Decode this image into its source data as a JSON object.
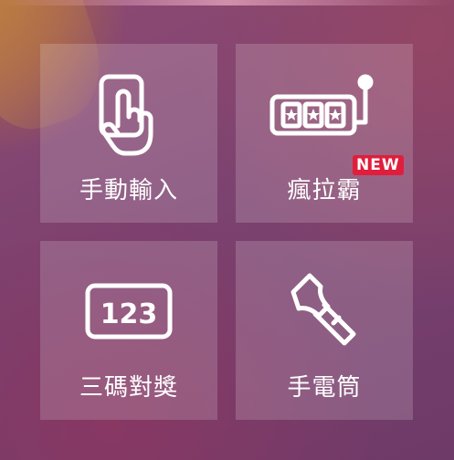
{
  "tiles": [
    {
      "label": "手動輸入",
      "icon": "hand-touch-icon"
    },
    {
      "label": "瘋拉霸",
      "icon": "slot-machine-icon",
      "badge": "NEW"
    },
    {
      "label": "三碼對獎",
      "icon": "number-123-icon",
      "icon_text": "123"
    },
    {
      "label": "手電筒",
      "icon": "flashlight-icon"
    }
  ],
  "colors": {
    "badge": "#e01e3c",
    "text": "#ffffff"
  }
}
